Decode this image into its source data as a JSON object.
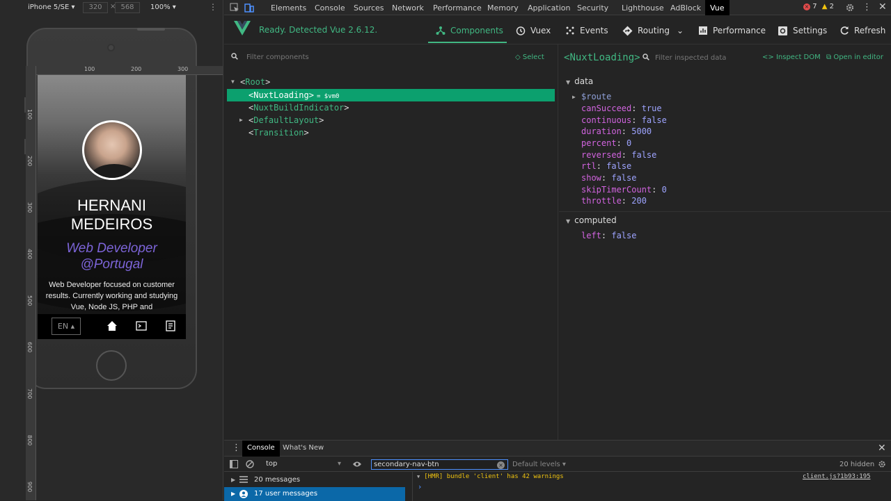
{
  "device_toolbar": {
    "device": "iPhone 5/SE",
    "width": "320",
    "height": "568",
    "separator": "×",
    "zoom": "100%"
  },
  "ruler": {
    "h_ticks": [
      "100",
      "200",
      "300"
    ],
    "v_ticks": [
      "100",
      "200",
      "300",
      "400",
      "500",
      "600",
      "700",
      "800",
      "900"
    ]
  },
  "site": {
    "name": "HERNANI MEDEIROS",
    "role": "Web Developer @Portugal",
    "bio": "Web Developer focused on customer results. Currently working and studying Vue, Node JS, PHP and",
    "lang": "EN"
  },
  "devtools_tabs": [
    "Elements",
    "Console",
    "Sources",
    "Network",
    "Performance",
    "Memory",
    "Application",
    "Security",
    "Lighthouse",
    "AdBlock",
    "Vue"
  ],
  "errors": {
    "errors": "7",
    "warnings": "2"
  },
  "vue": {
    "status": "Ready. Detected Vue 2.6.12.",
    "nav": {
      "components": "Components",
      "vuex": "Vuex",
      "events": "Events",
      "routing": "Routing",
      "performance": "Performance",
      "settings": "Settings",
      "refresh": "Refresh"
    },
    "filter_placeholder": "Filter components",
    "select": "Select",
    "tree": {
      "root": "Root",
      "nuxt_loading": "NuxtLoading",
      "vm0": "= $vm0",
      "nuxt_build": "NuxtBuildIndicator",
      "default_layout": "DefaultLayout",
      "transition": "Transition"
    },
    "inspected": "NuxtLoading",
    "inspect_filter_placeholder": "Filter inspected data",
    "inspect_dom": "Inspect DOM",
    "open_editor": "Open in editor",
    "data_title": "data",
    "route": "$route",
    "props": {
      "canSucceed": {
        "k": "canSucceed",
        "v": "true"
      },
      "continuous": {
        "k": "continuous",
        "v": "false"
      },
      "duration": {
        "k": "duration",
        "v": "5000"
      },
      "percent": {
        "k": "percent",
        "v": "0"
      },
      "reversed": {
        "k": "reversed",
        "v": "false"
      },
      "rtl": {
        "k": "rtl",
        "v": "false"
      },
      "show": {
        "k": "show",
        "v": "false"
      },
      "skipTimerCount": {
        "k": "skipTimerCount",
        "v": "0"
      },
      "throttle": {
        "k": "throttle",
        "v": "200"
      }
    },
    "computed_title": "computed",
    "computed": {
      "left": {
        "k": "left",
        "v": "false"
      }
    }
  },
  "console": {
    "tabs": {
      "console": "Console",
      "whats_new": "What's New"
    },
    "context": "top",
    "filter_value": "secondary-nav-btn",
    "levels": "Default levels",
    "hidden": "20 hidden",
    "sidebar": {
      "messages": "20 messages",
      "user_messages": "17 user messages"
    },
    "hmr": "[HMR] bundle 'client' has 42 warnings",
    "hmr_src": "client.js?1b93:195",
    "prompt": "›"
  },
  "colors": {
    "vue_green": "#41b883",
    "selected_row": "#0ca06e",
    "role_purple": "#7c64d8",
    "prop_key": "#d264e0",
    "prop_value": "#9ea4ff"
  }
}
